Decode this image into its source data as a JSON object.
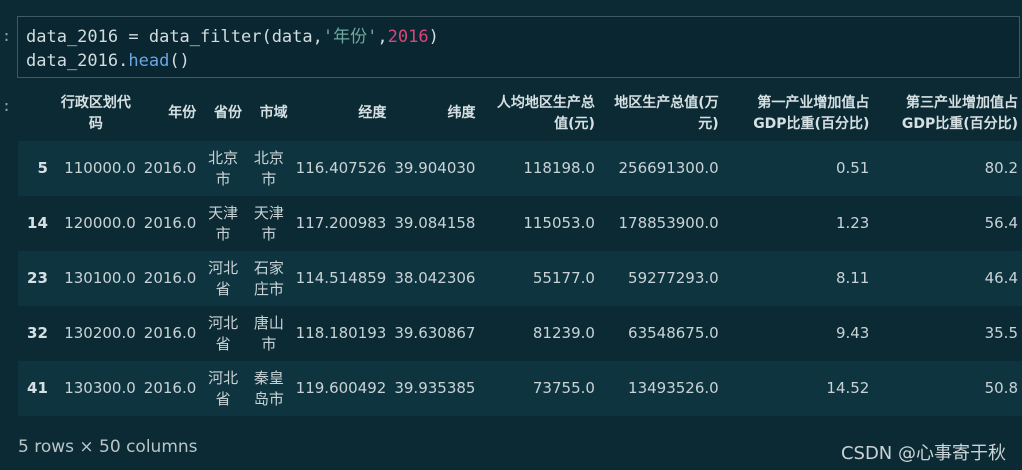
{
  "input_prompt": ":",
  "output_prompt": ":",
  "code": {
    "line1": {
      "var": "data_2016",
      "eq": " = ",
      "fn": "data_filter",
      "open": "(",
      "arg1": "data",
      ",": ",",
      "str": "'年份'",
      "sep": ",",
      "num": "2016",
      "close": ")"
    },
    "line2": {
      "var": "data_2016.",
      "method": "head",
      "parens": "()"
    }
  },
  "table": {
    "headers": [
      "行政区划代码",
      "年份",
      "省份",
      "市域",
      "经度",
      "纬度",
      "人均地区生产总值(元)",
      "地区生产总值(万元)",
      "第一产业增加值占GDP比重(百分比)",
      "第三产业增加值占GDP比重(百分比)"
    ],
    "rows": [
      {
        "index": "5",
        "cells": [
          "110000.0",
          "2016.0",
          "北京市",
          "北京市",
          "116.407526",
          "39.904030",
          "118198.0",
          "256691300.0",
          "0.51",
          "80.2"
        ]
      },
      {
        "index": "14",
        "cells": [
          "120000.0",
          "2016.0",
          "天津市",
          "天津市",
          "117.200983",
          "39.084158",
          "115053.0",
          "178853900.0",
          "1.23",
          "56.4"
        ]
      },
      {
        "index": "23",
        "cells": [
          "130100.0",
          "2016.0",
          "河北省",
          "石家庄市",
          "114.514859",
          "38.042306",
          "55177.0",
          "59277293.0",
          "8.11",
          "46.4"
        ]
      },
      {
        "index": "32",
        "cells": [
          "130200.0",
          "2016.0",
          "河北省",
          "唐山市",
          "118.180193",
          "39.630867",
          "81239.0",
          "63548675.0",
          "9.43",
          "35.5"
        ]
      },
      {
        "index": "41",
        "cells": [
          "130300.0",
          "2016.0",
          "河北省",
          "秦皇岛市",
          "119.600492",
          "39.935385",
          "73755.0",
          "13493526.0",
          "14.52",
          "50.8"
        ]
      }
    ]
  },
  "footer": "5 rows × 50 columns",
  "watermark": "CSDN @心事寄于秋"
}
